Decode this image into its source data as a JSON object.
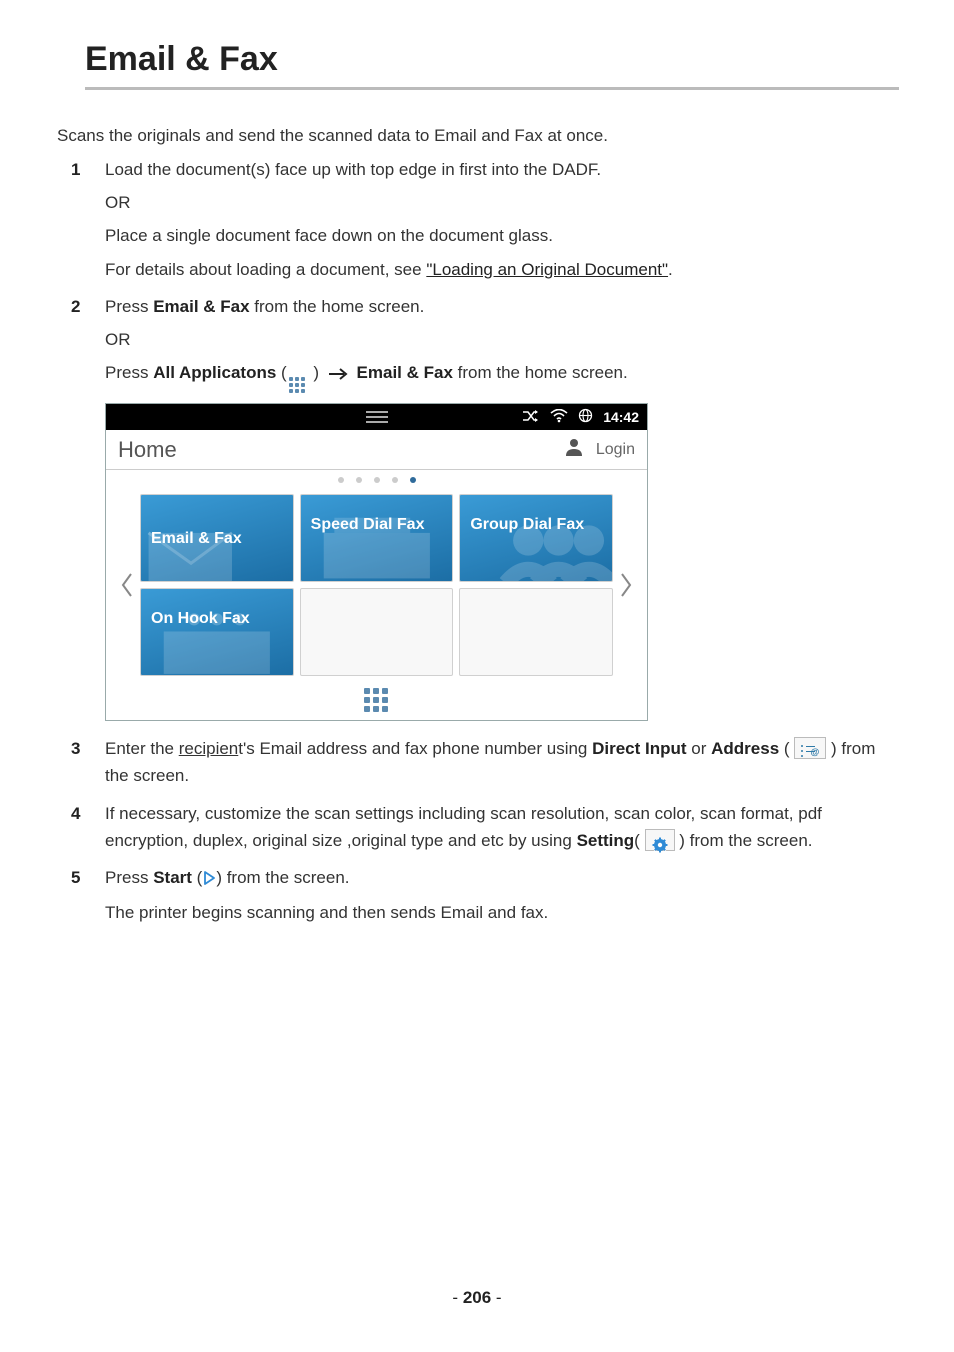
{
  "title": "Email & Fax",
  "intro": "Scans the originals and send the scanned data to Email and Fax at once.",
  "steps": {
    "s1": {
      "num": "1",
      "p1": "Load the document(s) face up with top edge in first into the DADF.",
      "or": "OR",
      "p2": "Place a single document face down on the document glass.",
      "p3_pre": "For details about loading a document, see ",
      "p3_link": "\"Loading an Original Document\"",
      "p3_post": "."
    },
    "s2": {
      "num": "2",
      "p1_pre": "Press ",
      "p1_bold": "Email & Fax",
      "p1_post": " from the home screen.",
      "or": "OR",
      "p2_pre": "Press ",
      "p2_bold": "All Applicatons",
      "p2_mid": " (",
      "p2_close": " )",
      "p2_bold2": "Email & Fax",
      "p2_post": " from the home screen."
    },
    "s3": {
      "num": "3",
      "p1_pre": "Enter the ",
      "p1_u": "recipien",
      "p1_mid": "t's Email address and fax phone number using ",
      "p1_bold1": "Direct Input",
      "p1_or": " or ",
      "p1_bold2": "Address",
      "p1_paren_open": " ( ",
      "p1_paren_close": " ) from the screen."
    },
    "s4": {
      "num": "4",
      "p1": "If necessary, customize the scan settings including scan resolution, scan color, scan format, pdf encryption, duplex, original size ,original type and etc by using ",
      "p1_bold": "Setting",
      "p1_post": "( ",
      "p1_end": " ) from the screen."
    },
    "s5": {
      "num": "5",
      "p1_pre": "Press ",
      "p1_bold": "Start",
      "p1_mid": " (",
      "p1_close": ") from the screen.",
      "p2": "The printer begins scanning and then sends Email and fax."
    }
  },
  "device": {
    "time": "14:42",
    "home": "Home",
    "login": "Login",
    "tiles": {
      "emailfax": "Email & Fax",
      "speeddial": "Speed Dial Fax",
      "groupdial": "Group Dial Fax",
      "onhook": "On Hook Fax"
    }
  },
  "page_number_prefix": "- ",
  "page_number": "206",
  "page_number_suffix": " -"
}
